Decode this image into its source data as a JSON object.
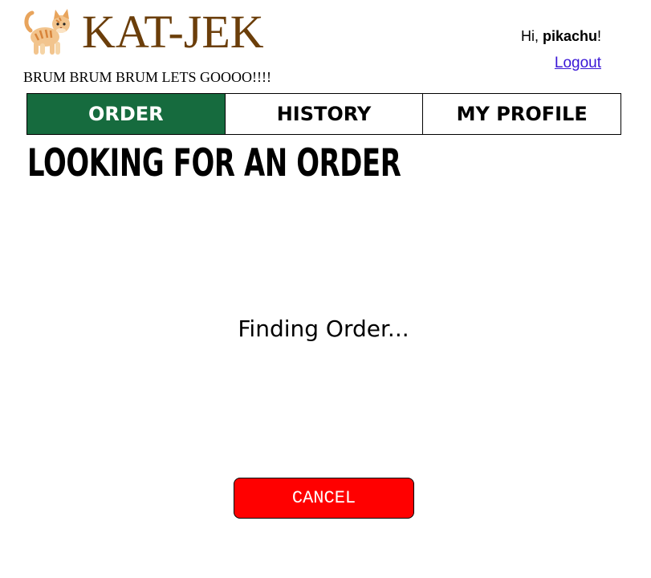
{
  "header": {
    "brand_title": "KAT-JEK",
    "brand_icon": "cat-icon",
    "tagline": "BRUM BRUM BRUM LETS GOOOO!!!!",
    "greeting_prefix": "Hi, ",
    "username": "pikachu",
    "greeting_suffix": "!",
    "logout_label": "Logout"
  },
  "tabs": [
    {
      "label": "ORDER",
      "active": true
    },
    {
      "label": "HISTORY",
      "active": false
    },
    {
      "label": "MY PROFILE",
      "active": false
    }
  ],
  "main": {
    "title": "LOOKING FOR AN ORDER",
    "status": "Finding Order...",
    "cancel_label": "CANCEL"
  },
  "colors": {
    "brand": "#6b3e0a",
    "active_tab": "#166b3e",
    "cancel": "#ff0000",
    "link": "#3a17d6"
  }
}
